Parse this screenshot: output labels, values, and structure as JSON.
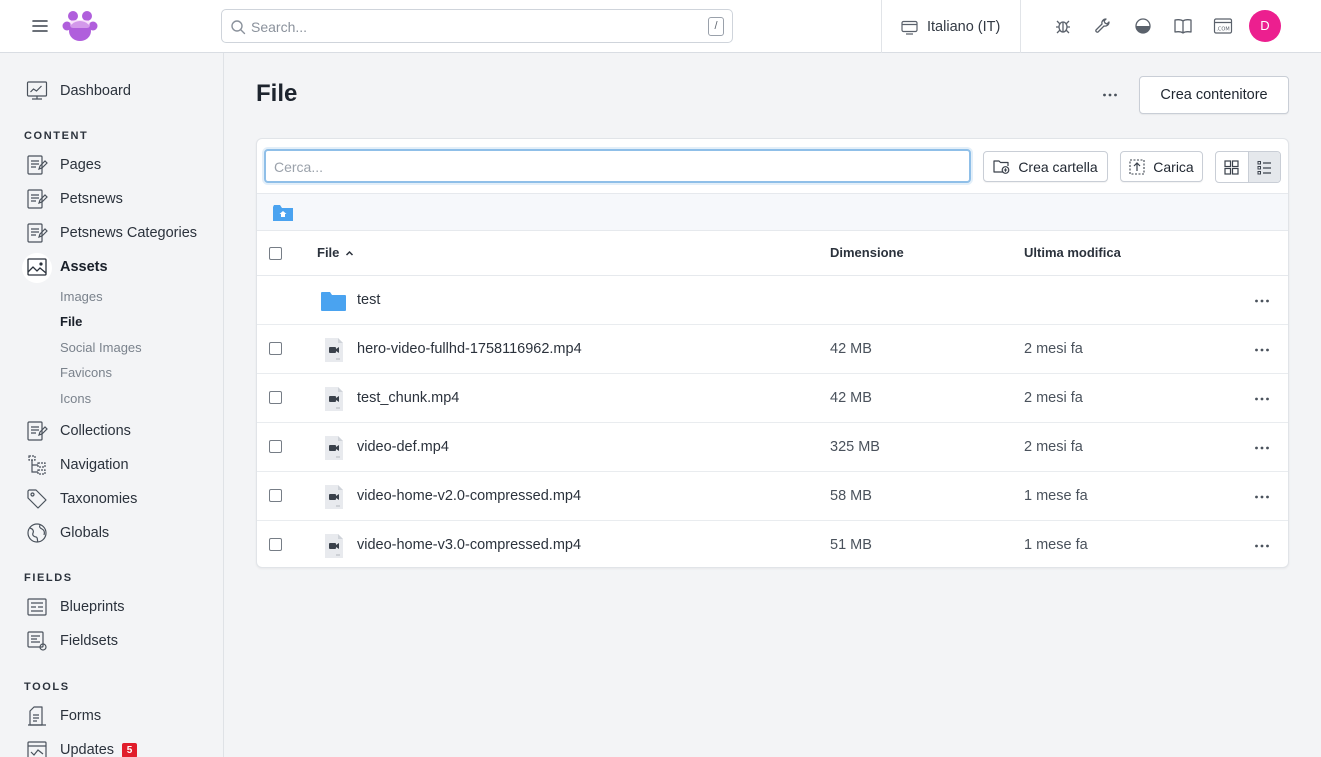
{
  "topbar": {
    "search_placeholder": "Search...",
    "search_shortcut": "/",
    "language": "Italiano (IT)",
    "avatar_initial": "D",
    "avatar_color": "#ec1f8f"
  },
  "sidebar": {
    "top": [
      {
        "label": "Dashboard",
        "icon": "dashboard-icon"
      }
    ],
    "sections": [
      {
        "heading": "CONTENT",
        "items": [
          "Pages",
          "Petsnews",
          "Petsnews Categories",
          "Assets",
          "Collections",
          "Navigation",
          "Taxonomies",
          "Globals"
        ]
      },
      {
        "heading": "FIELDS",
        "items": [
          "Blueprints",
          "Fieldsets"
        ]
      },
      {
        "heading": "TOOLS",
        "items": [
          "Forms",
          "Updates"
        ]
      }
    ],
    "assets_children": [
      "Images",
      "File",
      "Social Images",
      "Favicons",
      "Icons"
    ],
    "active_item": "Assets",
    "active_child": "File",
    "updates_badge": "5",
    "badge_color": "#e11d2b"
  },
  "main": {
    "title": "File",
    "create_container_label": "Crea contenitore",
    "filter_placeholder": "Cerca...",
    "create_folder_label": "Crea cartella",
    "upload_label": "Carica",
    "columns": {
      "file": "File",
      "size": "Dimensione",
      "modified": "Ultima modifica"
    },
    "sort_indicator": "ascending",
    "rows": [
      {
        "type": "folder",
        "name": "test",
        "size": "",
        "modified": ""
      },
      {
        "type": "video",
        "name": "hero-video-fullhd-1758116962.mp4",
        "size": "42 MB",
        "modified": "2 mesi fa"
      },
      {
        "type": "video",
        "name": "test_chunk.mp4",
        "size": "42 MB",
        "modified": "2 mesi fa"
      },
      {
        "type": "video",
        "name": "video-def.mp4",
        "size": "325 MB",
        "modified": "2 mesi fa"
      },
      {
        "type": "video",
        "name": "video-home-v2.0-compressed.mp4",
        "size": "58 MB",
        "modified": "1 mese fa"
      },
      {
        "type": "video",
        "name": "video-home-v3.0-compressed.mp4",
        "size": "51 MB",
        "modified": "1 mese fa"
      }
    ],
    "accent_color": "#4aa3f0"
  }
}
